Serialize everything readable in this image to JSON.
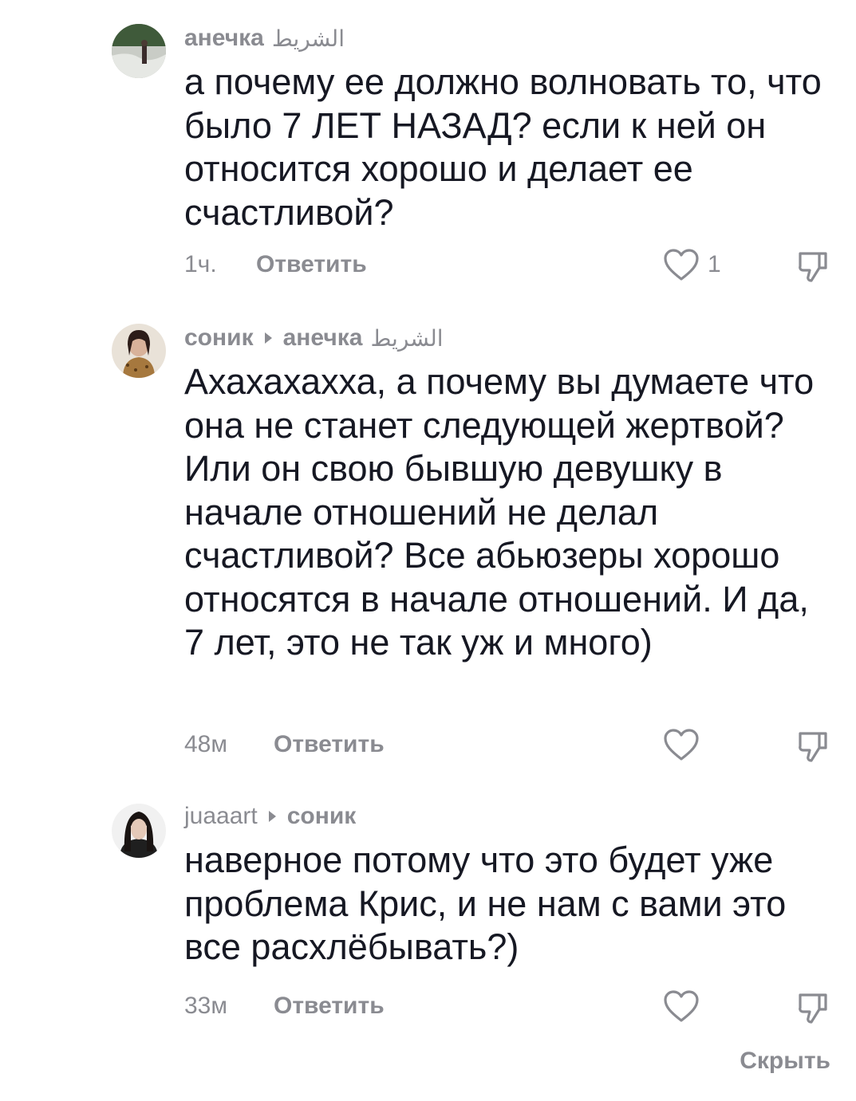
{
  "comments": [
    {
      "author": "анечка",
      "reply_to": "",
      "tag": "الشريط",
      "text": "а почему ее должно волновать то, что было 7 ЛЕТ НАЗАД? если к ней он относится хорошо и делает ее счастливой?",
      "time": "1ч.",
      "reply_label": "Ответить",
      "likes": "1"
    },
    {
      "author": "соник",
      "reply_to": "анечка",
      "tag": "الشريط",
      "text": "Ахахахахха, а почему вы думаете что она не станет следующей жертвой? Или он свою бывшую девушку в начале отношений не делал счастливой? Все абьюзеры хорошо относятся в начале отношений. И да, 7 лет, это не так уж и много)",
      "time": "48м",
      "reply_label": "Ответить",
      "likes": ""
    },
    {
      "author": "juaaart",
      "reply_to": "соник",
      "tag": "",
      "text": "наверное потому что это будет уже проблема Крис, и не нам с вами это все расхлёбывать?)",
      "time": "33м",
      "reply_label": "Ответить",
      "likes": ""
    }
  ],
  "hide_label": "Скрыть",
  "icons": {
    "like": "heart-outline-icon",
    "dislike": "thumbs-down-icon"
  },
  "colors": {
    "text": "#161823",
    "muted": "#8a8b91",
    "background": "#ffffff"
  }
}
